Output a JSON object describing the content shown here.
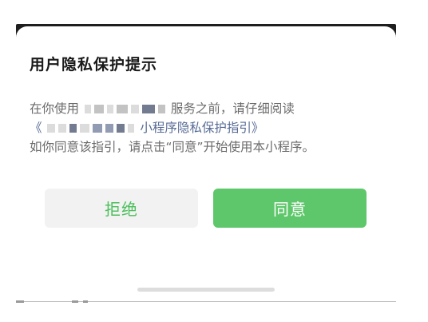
{
  "dialog": {
    "title": "用户隐私保护提示",
    "line1_prefix": "在你使用",
    "line1_suffix": "服务之前，请仔细阅读",
    "line2_open_quote": "《",
    "line2_link": "小程序隐私保护指引》",
    "line3": "如你同意该指引，请点击“同意”开始使用本小程序。",
    "reject_label": "拒绝",
    "agree_label": "同意"
  },
  "colors": {
    "link": "#576b95",
    "reject_text": "#4cbf5c",
    "agree_background": "#5fc76b"
  }
}
